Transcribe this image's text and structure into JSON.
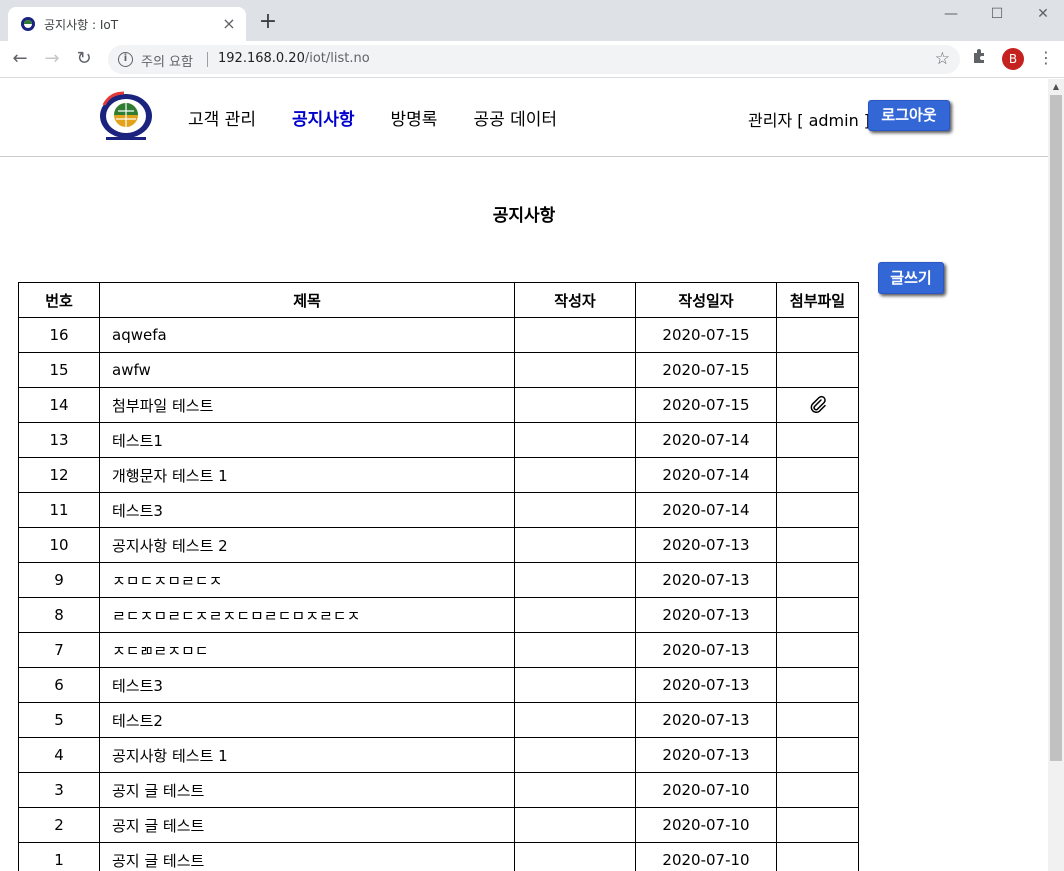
{
  "browser": {
    "tab_title": "공지사항 : IoT",
    "new_tab": "+",
    "security_label": "주의 요함",
    "url_host": "192.168.0.20",
    "url_path": "/iot/list.no",
    "profile_initial": "B",
    "window_min": "—",
    "window_max": "☐",
    "window_close": "✕"
  },
  "site": {
    "nav": [
      {
        "label": "고객 관리",
        "active": false
      },
      {
        "label": "공지사항",
        "active": true
      },
      {
        "label": "방명록",
        "active": false
      },
      {
        "label": "공공 데이터",
        "active": false
      }
    ],
    "user_info": "관리자 [ admin ]",
    "logout_label": "로그아웃"
  },
  "page": {
    "title": "공지사항",
    "write_label": "글쓰기",
    "columns": [
      "번호",
      "제목",
      "작성자",
      "작성일자",
      "첨부파일"
    ],
    "rows": [
      {
        "no": "16",
        "title": "aqwefa",
        "writer": "",
        "date": "2020-07-15",
        "attach": false
      },
      {
        "no": "15",
        "title": "awfw",
        "writer": "",
        "date": "2020-07-15",
        "attach": false
      },
      {
        "no": "14",
        "title": "첨부파일 테스트",
        "writer": "",
        "date": "2020-07-15",
        "attach": true
      },
      {
        "no": "13",
        "title": "테스트1",
        "writer": "",
        "date": "2020-07-14",
        "attach": false
      },
      {
        "no": "12",
        "title": "개행문자 테스트 1",
        "writer": "",
        "date": "2020-07-14",
        "attach": false
      },
      {
        "no": "11",
        "title": "테스트3",
        "writer": "",
        "date": "2020-07-14",
        "attach": false
      },
      {
        "no": "10",
        "title": "공지사항 테스트 2",
        "writer": "",
        "date": "2020-07-13",
        "attach": false
      },
      {
        "no": "9",
        "title": "ㅈㅁㄷㅈㅁㄹㄷㅈ",
        "writer": "",
        "date": "2020-07-13",
        "attach": false
      },
      {
        "no": "8",
        "title": "ㄹㄷㅈㅁㄹㄷㅈㄹㅈㄷㅁㄹㄷㅁㅈㄹㄷㅈ",
        "writer": "",
        "date": "2020-07-13",
        "attach": false
      },
      {
        "no": "7",
        "title": "ㅈㄷㄻㄹㅈㅁㄷ",
        "writer": "",
        "date": "2020-07-13",
        "attach": false
      },
      {
        "no": "6",
        "title": "테스트3",
        "writer": "",
        "date": "2020-07-13",
        "attach": false
      },
      {
        "no": "5",
        "title": "테스트2",
        "writer": "",
        "date": "2020-07-13",
        "attach": false
      },
      {
        "no": "4",
        "title": "공지사항 테스트 1",
        "writer": "",
        "date": "2020-07-13",
        "attach": false
      },
      {
        "no": "3",
        "title": "공지 글 테스트",
        "writer": "",
        "date": "2020-07-10",
        "attach": false
      },
      {
        "no": "2",
        "title": "공지 글 테스트",
        "writer": "",
        "date": "2020-07-10",
        "attach": false
      },
      {
        "no": "1",
        "title": "공지 글 테스트",
        "writer": "",
        "date": "2020-07-10",
        "attach": false
      }
    ]
  },
  "colors": {
    "accent_button": "#3367d6",
    "active_nav": "#0000cd"
  }
}
